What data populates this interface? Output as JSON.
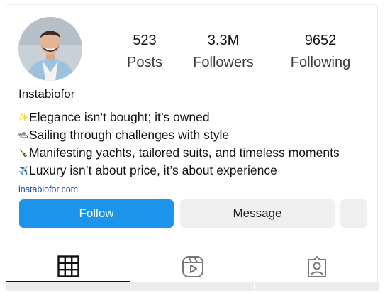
{
  "profile": {
    "username": "Instabiofor",
    "stats": [
      {
        "value": "523",
        "label": "Posts"
      },
      {
        "value": "3.3M",
        "label": "Followers"
      },
      {
        "value": "9652",
        "label": "Following"
      }
    ],
    "bio": [
      {
        "emoji": "✨",
        "text": "Elegance isn’t bought; it’s owned"
      },
      {
        "emoji": "🛥",
        "text": "Sailing through challenges with style"
      },
      {
        "emoji": "🍾",
        "text": "Manifesting yachts, tailored suits, and timeless moments"
      },
      {
        "emoji": "✈️",
        "text": "Luxury isn’t about price, it’s about experience"
      }
    ],
    "link": "instabiofor.com"
  },
  "actions": {
    "follow_label": "Follow",
    "message_label": "Message"
  },
  "tabs": [
    {
      "name": "grid",
      "icon": "grid-icon",
      "active": true
    },
    {
      "name": "reels",
      "icon": "reels-icon",
      "active": false
    },
    {
      "name": "tagged",
      "icon": "tagged-icon",
      "active": false
    }
  ],
  "colors": {
    "follow_button": "#1b95ec",
    "link": "#1a4fa3",
    "secondary_button": "#efefef"
  }
}
